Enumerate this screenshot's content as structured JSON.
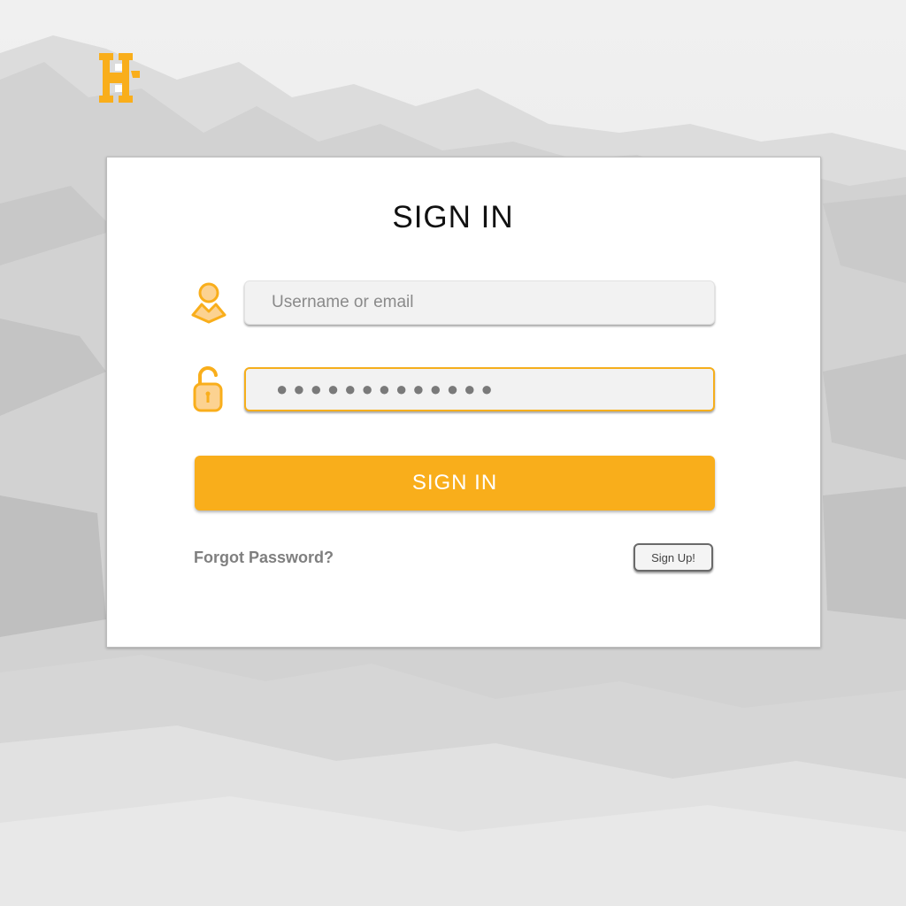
{
  "brand": {
    "logo_letter": "H",
    "accent_color": "#F9AE1B"
  },
  "signin": {
    "title": "SIGN IN",
    "username": {
      "placeholder": "Username or email",
      "value": "",
      "icon": "user-icon"
    },
    "password": {
      "value": "●●●●●●●●●●●●●",
      "icon": "lock-open-icon"
    },
    "submit_label": "SIGN IN",
    "forgot_label": "Forgot Password?",
    "signup_label": "Sign Up!"
  }
}
